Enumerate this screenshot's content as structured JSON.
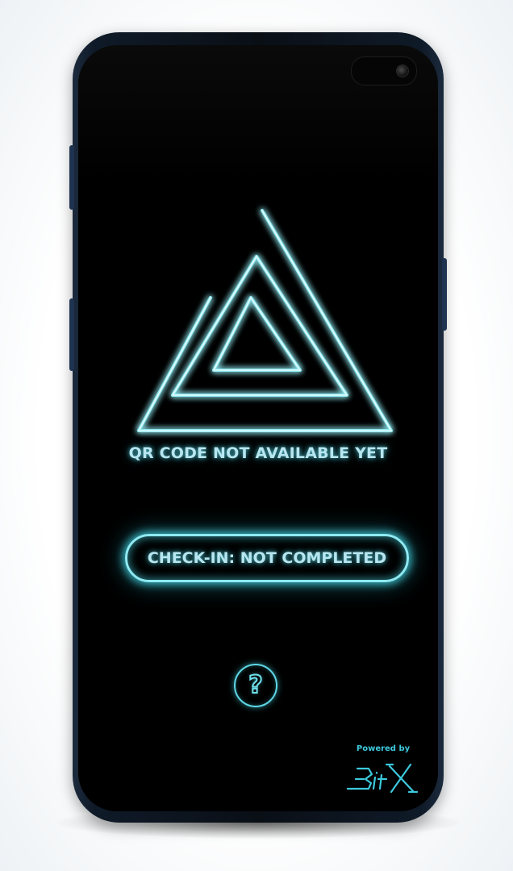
{
  "status": {
    "qr_message": "QR CODE NOT AVAILABLE YET"
  },
  "checkin": {
    "label": "CHECK-IN: NOT COMPLETED"
  },
  "help": {
    "glyph": "?"
  },
  "footer": {
    "powered_by": "Powered by",
    "brand_logo": "BitX"
  },
  "icons": {
    "logo": "neon-triangles-icon",
    "help": "question-mark-icon",
    "brand": "bitx-logo"
  },
  "colors": {
    "screen_background": "#000000",
    "neon_accent": "#5fd8e6",
    "text_glow": "#b8e6f0",
    "phone_frame": "#0f1a28"
  }
}
